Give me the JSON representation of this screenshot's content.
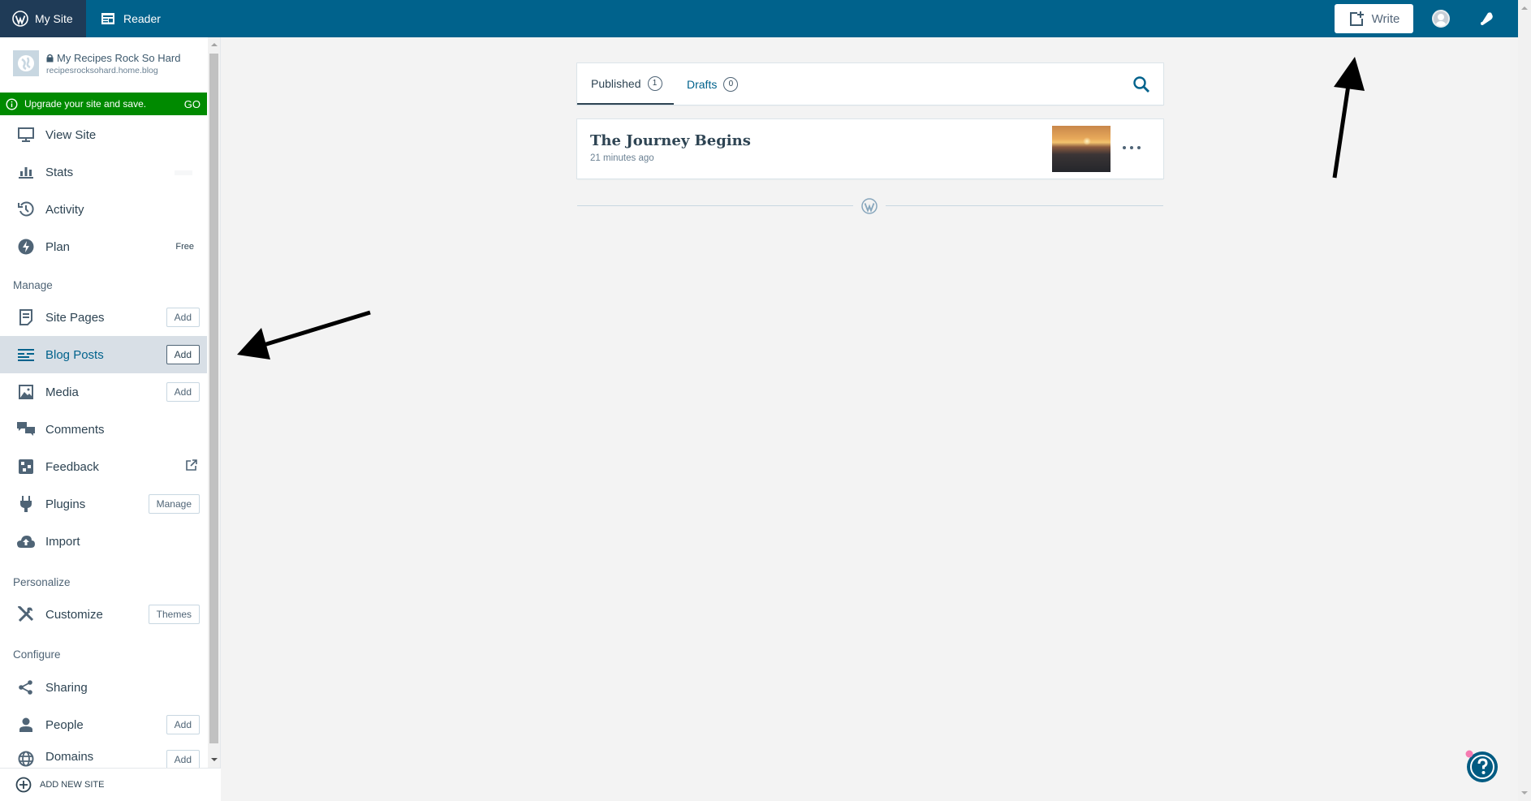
{
  "masterbar": {
    "my_site_label": "My Site",
    "reader_label": "Reader",
    "write_label": "Write",
    "colors": {
      "bar": "#00628c",
      "active_tab": "#1f3b57"
    }
  },
  "site": {
    "title": "My Recipes Rock So Hard",
    "url": "recipesrocksohard.home.blog"
  },
  "upgrade_banner": {
    "text": "Upgrade your site and save.",
    "action": "GO",
    "color": "#008a00"
  },
  "sidebar": {
    "items_top": [
      {
        "label": "View Site",
        "icon": "monitor-icon"
      },
      {
        "label": "Stats",
        "icon": "stats-icon"
      },
      {
        "label": "Activity",
        "icon": "history-icon"
      },
      {
        "label": "Plan",
        "icon": "plan-icon",
        "badge": "Free"
      }
    ],
    "sections": {
      "manage": "Manage",
      "personalize": "Personalize",
      "configure": "Configure"
    },
    "manage_items": [
      {
        "label": "Site Pages",
        "icon": "page-icon",
        "button": "Add"
      },
      {
        "label": "Blog Posts",
        "icon": "posts-icon",
        "button": "Add",
        "active": true
      },
      {
        "label": "Media",
        "icon": "image-icon",
        "button": "Add"
      },
      {
        "label": "Comments",
        "icon": "comments-icon"
      },
      {
        "label": "Feedback",
        "icon": "feedback-icon",
        "external": true
      },
      {
        "label": "Plugins",
        "icon": "plug-icon",
        "button": "Manage"
      },
      {
        "label": "Import",
        "icon": "cloud-upload-icon"
      }
    ],
    "personalize_items": [
      {
        "label": "Customize",
        "icon": "tools-icon",
        "button": "Themes"
      }
    ],
    "configure_items": [
      {
        "label": "Sharing",
        "icon": "share-icon"
      },
      {
        "label": "People",
        "icon": "person-icon",
        "button": "Add"
      },
      {
        "label": "Domains",
        "icon": "globe-icon",
        "button": "Add"
      }
    ],
    "add_new_site": "ADD NEW SITE"
  },
  "posts": {
    "tabs": [
      {
        "label": "Published",
        "count": "1",
        "selected": true
      },
      {
        "label": "Drafts",
        "count": "0",
        "selected": false
      }
    ],
    "list": [
      {
        "title": "The Journey Begins",
        "meta": "21 minutes ago"
      }
    ]
  },
  "accent_color": "#00628c"
}
